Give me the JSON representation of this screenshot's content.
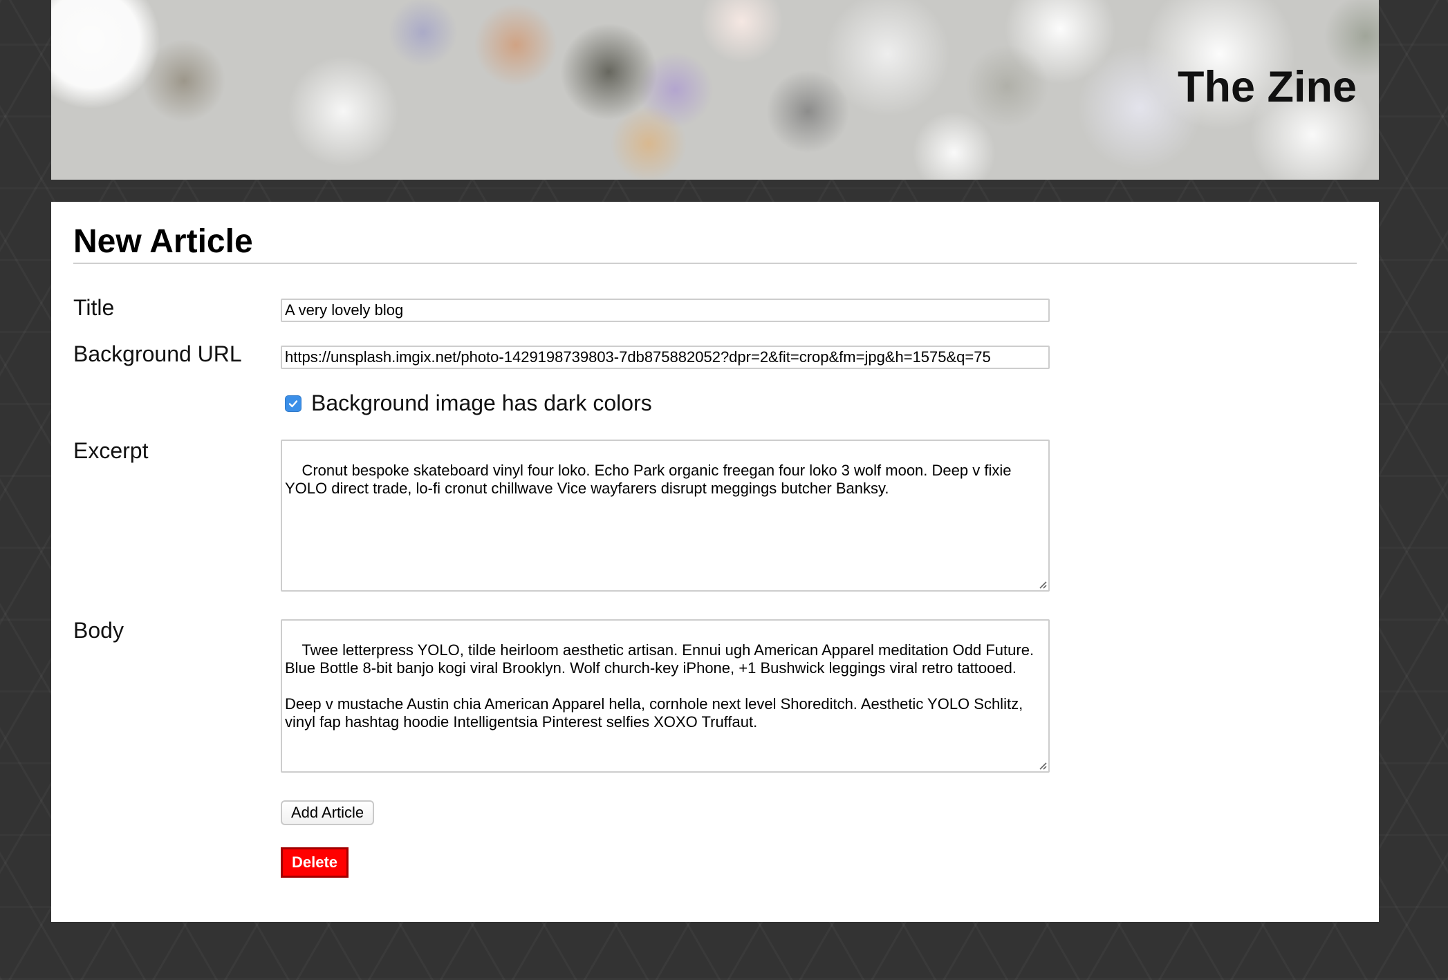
{
  "header": {
    "site_title": "The Zine"
  },
  "form": {
    "page_title": "New Article",
    "title": {
      "label": "Title",
      "value": "A very lovely blog"
    },
    "background_url": {
      "label": "Background URL",
      "value": "https://unsplash.imgix.net/photo-1429198739803-7db875882052?dpr=2&fit=crop&fm=jpg&h=1575&q=75"
    },
    "dark_colors": {
      "label": "Background image has dark colors",
      "checked": true
    },
    "excerpt": {
      "label": "Excerpt",
      "value": "Cronut bespoke skateboard vinyl four loko. Echo Park organic freegan four loko 3 wolf moon. Deep v fixie YOLO direct trade, lo-fi cronut chillwave Vice wayfarers disrupt meggings butcher Banksy."
    },
    "body": {
      "label": "Body",
      "value": "Twee letterpress YOLO, tilde heirloom aesthetic artisan. Ennui ugh American Apparel meditation Odd Future. Blue Bottle 8-bit banjo kogi viral Brooklyn. Wolf church-key iPhone, +1 Bushwick leggings viral retro tattooed.\n\nDeep v mustache Austin chia American Apparel hella, cornhole next level Shoreditch. Aesthetic YOLO Schlitz, vinyl fap hashtag hoodie Intelligentsia Pinterest selfies XOXO Truffaut."
    },
    "add_button_label": "Add Article",
    "delete_button_label": "Delete"
  },
  "colors": {
    "page_background": "#333333",
    "panel_background": "#ffffff",
    "checkbox_accent": "#3b8fe8",
    "delete_button": "#ff0000"
  }
}
